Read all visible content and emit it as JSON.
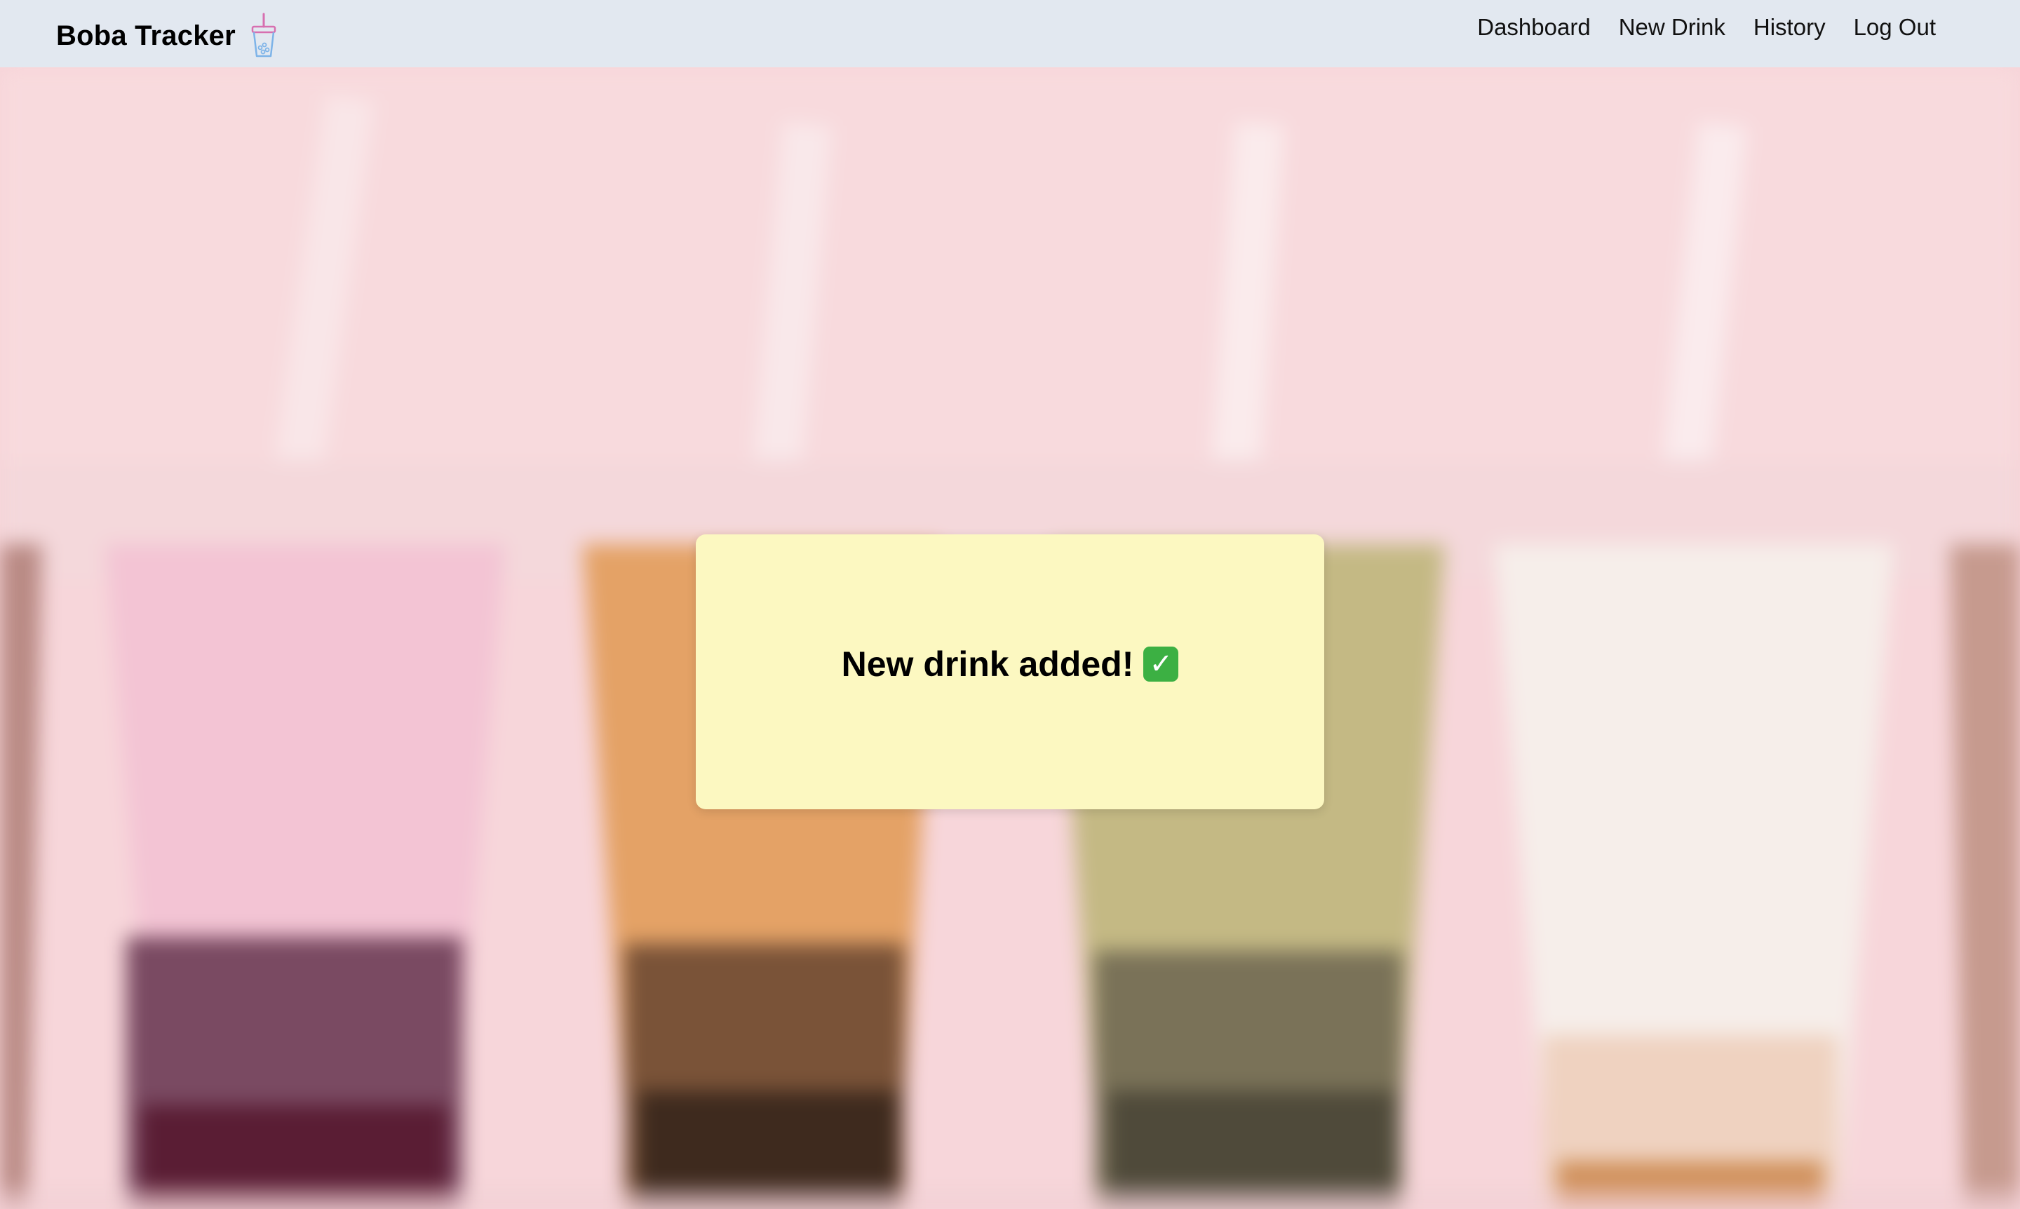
{
  "app": {
    "title": "Boba Tracker",
    "brand_icon": "boba-cup-icon"
  },
  "nav": {
    "items": [
      {
        "label": "Dashboard"
      },
      {
        "label": "New Drink"
      },
      {
        "label": "History"
      },
      {
        "label": "Log Out"
      }
    ]
  },
  "toast": {
    "message": "New drink added!",
    "icon": "check-mark-icon",
    "icon_glyph": "✓",
    "background": "#fcf8c1"
  },
  "colors": {
    "navbar": "#e2e8f0",
    "background": "#f6d3d8",
    "check_green": "#3cb043"
  }
}
